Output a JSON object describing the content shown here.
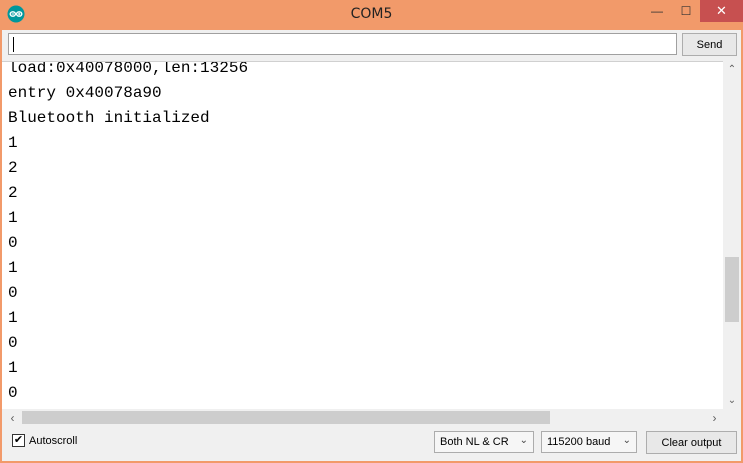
{
  "window": {
    "title": "COM5",
    "minimize_glyph": "—",
    "maximize_glyph": "☐",
    "close_glyph": "✕"
  },
  "input": {
    "value": "",
    "send_label": "Send"
  },
  "console": {
    "lines": [
      "load:0x40078000,len:13256",
      "entry 0x40078a90",
      "Bluetooth initialized",
      "1",
      "2",
      "2",
      "1",
      "0",
      "1",
      "0",
      "1",
      "0",
      "1",
      "0"
    ]
  },
  "footer": {
    "autoscroll_label": "Autoscroll",
    "autoscroll_checked": true,
    "line_ending": "Both NL & CR",
    "baud_rate": "115200 baud",
    "clear_label": "Clear output"
  },
  "icons": {
    "app": "arduino-icon",
    "scroll_up": "up-arrow-icon",
    "scroll_down": "down-arrow-icon",
    "scroll_left": "left-arrow-icon",
    "scroll_right": "right-arrow-icon"
  },
  "colors": {
    "title_bar": "#f29a6a",
    "close_button": "#c75050",
    "arduino_teal": "#00979c"
  }
}
